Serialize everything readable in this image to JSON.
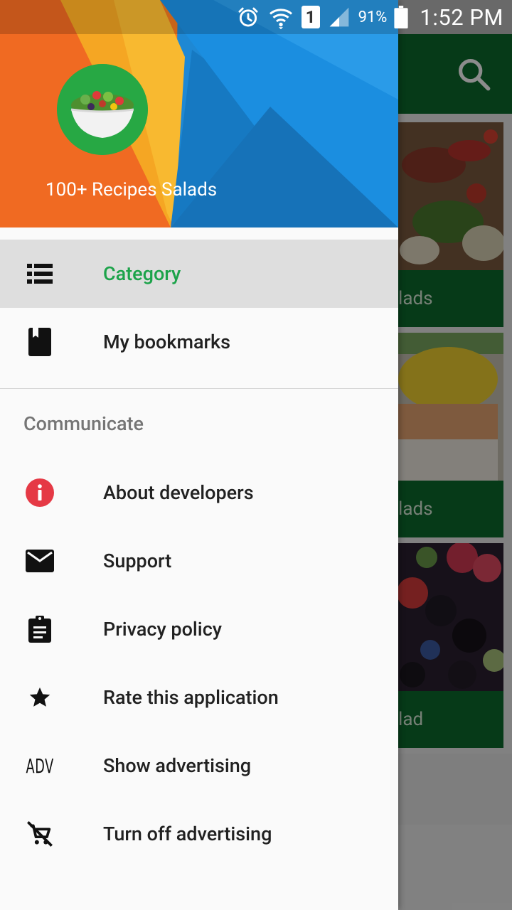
{
  "status_bar": {
    "battery_percent": "91%",
    "time": "1:52 PM",
    "sim_slot": "1",
    "icons": [
      "alarm-icon",
      "wifi-icon",
      "sim-icon",
      "signal-icon",
      "battery-icon"
    ]
  },
  "drawer": {
    "app_name": "100+ Recipes Salads",
    "primary_items": [
      {
        "label": "Category",
        "icon": "list-icon",
        "active": true
      },
      {
        "label": "My bookmarks",
        "icon": "bookmark-icon",
        "active": false
      }
    ],
    "section_title": "Communicate",
    "communicate_items": [
      {
        "label": "About developers",
        "icon": "info-icon"
      },
      {
        "label": "Support",
        "icon": "mail-icon"
      },
      {
        "label": "Privacy policy",
        "icon": "clipboard-icon"
      },
      {
        "label": "Rate this application",
        "icon": "star-icon"
      },
      {
        "label": "Show advertising",
        "icon": "adv-icon",
        "icon_text": "ADV"
      },
      {
        "label": "Turn off advertising",
        "icon": "remove-cart-icon"
      }
    ]
  },
  "background_app": {
    "cards": [
      {
        "label_fragment": "lads"
      },
      {
        "label_fragment": "lads"
      },
      {
        "label_fragment": "lad"
      }
    ]
  },
  "colors": {
    "accent_green": "#1ca34a",
    "toolbar_green": "#0b6a2c",
    "info_red": "#e53945"
  }
}
